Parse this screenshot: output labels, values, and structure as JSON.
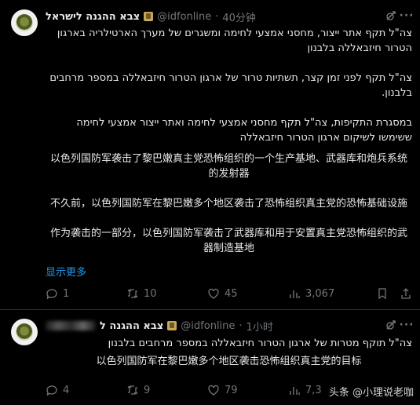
{
  "tweets": [
    {
      "name": "צבא ההגנה לישראל",
      "handle": "@idfonline",
      "time": "40分钟",
      "he_paragraphs": [
        "צה\"ל תקף אתר ייצור, מחסני אמצעי לחימה ומשגרים של מערך הארטילריה בארגון הטרור חיזבאללה בלבנון",
        "צה\"ל תקף לפני זמן קצר, תשתיות טרור של ארגון הטרור חיזבאללה במספר מרחבים בלבנון.",
        "במסגרת התקיפות, צה\"ל תקף מחסני אמצעי לחימה ואתר ייצור אמצעי לחימה ששימשו לשיקום ארגון הטרור חיזבאללה"
      ],
      "zh_paragraphs": [
        "以色列国防军袭击了黎巴嫩真主党恐怖组织的一个生产基地、武器库和炮兵系统的发射器",
        "不久前，以色列国防军在黎巴嫩多个地区袭击了恐怖组织真主党的恐怖基础设施",
        "作为袭击的一部分，以色列国防军袭击了武器库和用于安置真主党恐怖组织的武器制造基地"
      ],
      "show_more": "显示更多",
      "replies": "1",
      "reposts": "10",
      "likes": "45",
      "views": "3,067"
    },
    {
      "name": "צבא ההגנה ל",
      "handle": "@idfonline",
      "time": "1小时",
      "he_paragraphs": [
        "צה\"ל תוקף מטרות של ארגון הטרור חיזבאללה במספר מרחבים בלבנון"
      ],
      "zh_paragraphs": [
        "以色列国防军在黎巴嫩多个地区袭击恐怖组织真主党的目标"
      ],
      "replies": "4",
      "reposts": "9",
      "likes": "79",
      "views": "7,3"
    }
  ],
  "watermark": "头条 @小理说老咖",
  "colors": {
    "background": "#000000",
    "text": "#e7e9ea",
    "muted": "#71767b",
    "link": "#1d9bf0",
    "divider": "#2f3336"
  }
}
